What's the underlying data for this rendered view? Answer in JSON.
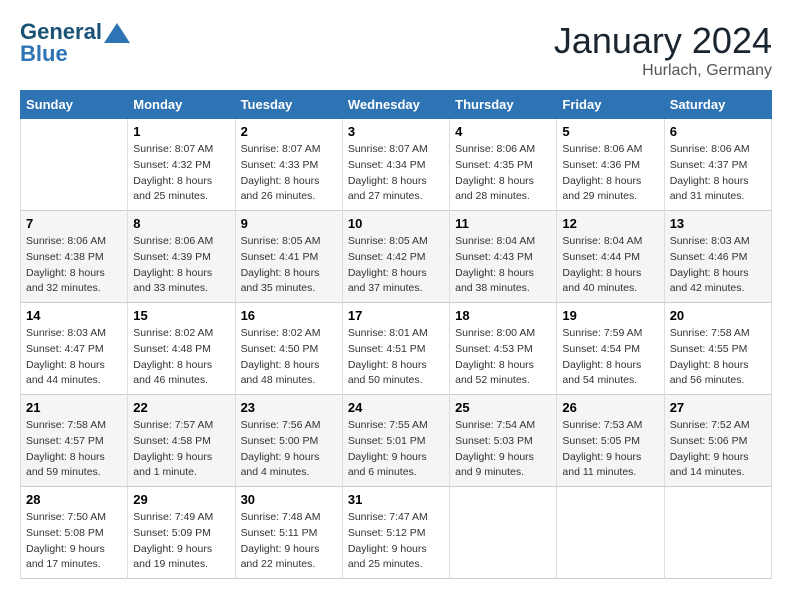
{
  "header": {
    "logo_line1": "General",
    "logo_line2": "Blue",
    "month_title": "January 2024",
    "location": "Hurlach, Germany"
  },
  "columns": [
    "Sunday",
    "Monday",
    "Tuesday",
    "Wednesday",
    "Thursday",
    "Friday",
    "Saturday"
  ],
  "weeks": [
    [
      {
        "day": "",
        "details": ""
      },
      {
        "day": "1",
        "details": "Sunrise: 8:07 AM\nSunset: 4:32 PM\nDaylight: 8 hours\nand 25 minutes."
      },
      {
        "day": "2",
        "details": "Sunrise: 8:07 AM\nSunset: 4:33 PM\nDaylight: 8 hours\nand 26 minutes."
      },
      {
        "day": "3",
        "details": "Sunrise: 8:07 AM\nSunset: 4:34 PM\nDaylight: 8 hours\nand 27 minutes."
      },
      {
        "day": "4",
        "details": "Sunrise: 8:06 AM\nSunset: 4:35 PM\nDaylight: 8 hours\nand 28 minutes."
      },
      {
        "day": "5",
        "details": "Sunrise: 8:06 AM\nSunset: 4:36 PM\nDaylight: 8 hours\nand 29 minutes."
      },
      {
        "day": "6",
        "details": "Sunrise: 8:06 AM\nSunset: 4:37 PM\nDaylight: 8 hours\nand 31 minutes."
      }
    ],
    [
      {
        "day": "7",
        "details": "Sunrise: 8:06 AM\nSunset: 4:38 PM\nDaylight: 8 hours\nand 32 minutes."
      },
      {
        "day": "8",
        "details": "Sunrise: 8:06 AM\nSunset: 4:39 PM\nDaylight: 8 hours\nand 33 minutes."
      },
      {
        "day": "9",
        "details": "Sunrise: 8:05 AM\nSunset: 4:41 PM\nDaylight: 8 hours\nand 35 minutes."
      },
      {
        "day": "10",
        "details": "Sunrise: 8:05 AM\nSunset: 4:42 PM\nDaylight: 8 hours\nand 37 minutes."
      },
      {
        "day": "11",
        "details": "Sunrise: 8:04 AM\nSunset: 4:43 PM\nDaylight: 8 hours\nand 38 minutes."
      },
      {
        "day": "12",
        "details": "Sunrise: 8:04 AM\nSunset: 4:44 PM\nDaylight: 8 hours\nand 40 minutes."
      },
      {
        "day": "13",
        "details": "Sunrise: 8:03 AM\nSunset: 4:46 PM\nDaylight: 8 hours\nand 42 minutes."
      }
    ],
    [
      {
        "day": "14",
        "details": "Sunrise: 8:03 AM\nSunset: 4:47 PM\nDaylight: 8 hours\nand 44 minutes."
      },
      {
        "day": "15",
        "details": "Sunrise: 8:02 AM\nSunset: 4:48 PM\nDaylight: 8 hours\nand 46 minutes."
      },
      {
        "day": "16",
        "details": "Sunrise: 8:02 AM\nSunset: 4:50 PM\nDaylight: 8 hours\nand 48 minutes."
      },
      {
        "day": "17",
        "details": "Sunrise: 8:01 AM\nSunset: 4:51 PM\nDaylight: 8 hours\nand 50 minutes."
      },
      {
        "day": "18",
        "details": "Sunrise: 8:00 AM\nSunset: 4:53 PM\nDaylight: 8 hours\nand 52 minutes."
      },
      {
        "day": "19",
        "details": "Sunrise: 7:59 AM\nSunset: 4:54 PM\nDaylight: 8 hours\nand 54 minutes."
      },
      {
        "day": "20",
        "details": "Sunrise: 7:58 AM\nSunset: 4:55 PM\nDaylight: 8 hours\nand 56 minutes."
      }
    ],
    [
      {
        "day": "21",
        "details": "Sunrise: 7:58 AM\nSunset: 4:57 PM\nDaylight: 8 hours\nand 59 minutes."
      },
      {
        "day": "22",
        "details": "Sunrise: 7:57 AM\nSunset: 4:58 PM\nDaylight: 9 hours\nand 1 minute."
      },
      {
        "day": "23",
        "details": "Sunrise: 7:56 AM\nSunset: 5:00 PM\nDaylight: 9 hours\nand 4 minutes."
      },
      {
        "day": "24",
        "details": "Sunrise: 7:55 AM\nSunset: 5:01 PM\nDaylight: 9 hours\nand 6 minutes."
      },
      {
        "day": "25",
        "details": "Sunrise: 7:54 AM\nSunset: 5:03 PM\nDaylight: 9 hours\nand 9 minutes."
      },
      {
        "day": "26",
        "details": "Sunrise: 7:53 AM\nSunset: 5:05 PM\nDaylight: 9 hours\nand 11 minutes."
      },
      {
        "day": "27",
        "details": "Sunrise: 7:52 AM\nSunset: 5:06 PM\nDaylight: 9 hours\nand 14 minutes."
      }
    ],
    [
      {
        "day": "28",
        "details": "Sunrise: 7:50 AM\nSunset: 5:08 PM\nDaylight: 9 hours\nand 17 minutes."
      },
      {
        "day": "29",
        "details": "Sunrise: 7:49 AM\nSunset: 5:09 PM\nDaylight: 9 hours\nand 19 minutes."
      },
      {
        "day": "30",
        "details": "Sunrise: 7:48 AM\nSunset: 5:11 PM\nDaylight: 9 hours\nand 22 minutes."
      },
      {
        "day": "31",
        "details": "Sunrise: 7:47 AM\nSunset: 5:12 PM\nDaylight: 9 hours\nand 25 minutes."
      },
      {
        "day": "",
        "details": ""
      },
      {
        "day": "",
        "details": ""
      },
      {
        "day": "",
        "details": ""
      }
    ]
  ]
}
